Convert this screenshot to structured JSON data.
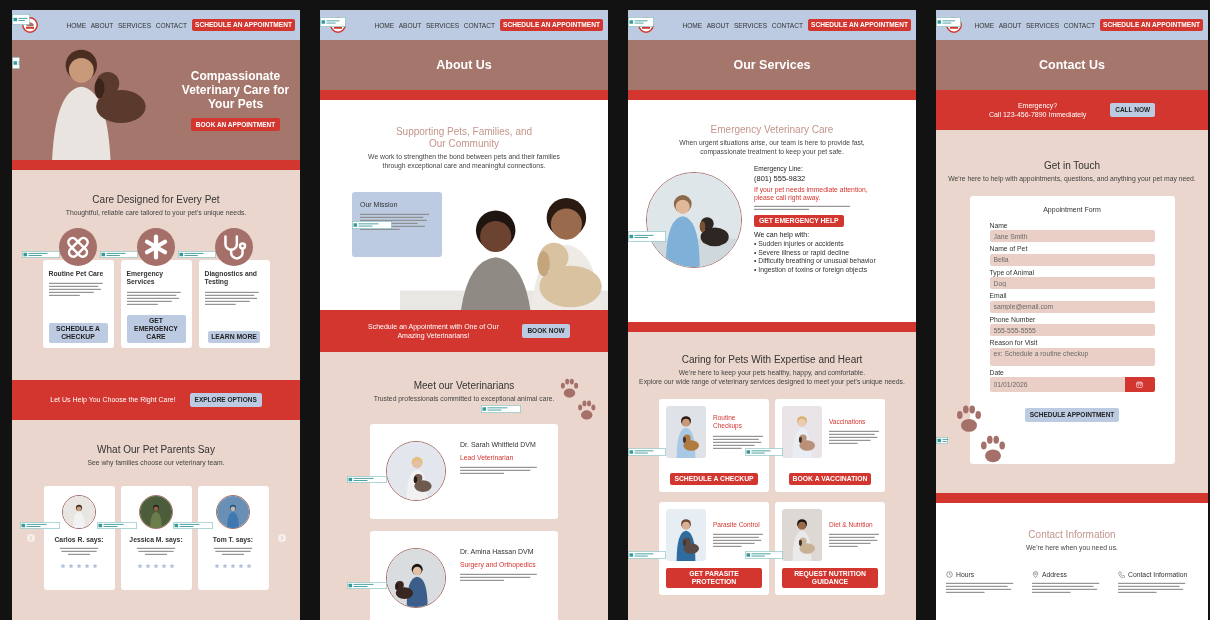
{
  "pages": [
    {
      "nav": {
        "links": [
          "HOME",
          "ABOUT",
          "SERVICES",
          "CONTACT"
        ],
        "button": "SCHEDULE AN APPOINTMENT"
      },
      "sections": [
        {
          "kind": "hero",
          "title": "Compassionate Veterinary Care for Your Pets",
          "button": "BOOK AN APPOINTMENT"
        },
        {
          "kind": "band"
        },
        {
          "kind": "features",
          "title": "Care Designed for Every Pet",
          "subtitle": "Thoughtful, reliable care tailored to your pet's unique needs.",
          "cards": [
            {
              "title": "Routine Pet Care",
              "button": "SCHEDULE A CHECKUP"
            },
            {
              "title": "Emergency Services",
              "button": "GET EMERGENCY CARE"
            },
            {
              "title": "Diagnostics and Testing",
              "button": "LEARN MORE"
            }
          ]
        },
        {
          "kind": "cta",
          "text": "Let Us Help You Choose the Right Care!",
          "button": "EXPLORE OPTIONS"
        },
        {
          "kind": "testimonials",
          "title": "What Our Pet Parents Say",
          "subtitle": "See why families choose our veterinary team.",
          "items": [
            {
              "name": "Carlos R. says:",
              "stars": 5
            },
            {
              "name": "Jessica M. says:",
              "stars": 5
            },
            {
              "name": "Tom T. says:",
              "stars": 5
            }
          ]
        }
      ]
    },
    {
      "nav": {
        "links": [
          "HOME",
          "ABOUT",
          "SERVICES",
          "CONTACT"
        ],
        "button": "SCHEDULE AN APPOINTMENT"
      },
      "sections": [
        {
          "kind": "banner",
          "title": "About Us"
        },
        {
          "kind": "band"
        },
        {
          "kind": "intro",
          "title": "Supporting Pets, Families, and Our Community",
          "subtitle": "We work to strengthen the bond between pets and their families through exceptional care and meaningful connections.",
          "panel_title": "Our Mission"
        },
        {
          "kind": "cta",
          "text": "Schedule an Appointment with One of Our Amazing Veterinarians!",
          "button": "BOOK NOW"
        },
        {
          "kind": "team",
          "title": "Meet our Veterinarians",
          "subtitle": "Trusted professionals committed to exceptional animal care.",
          "members": [
            {
              "name": "Dr. Sarah Whitfield DVM",
              "role": "Lead Veterinarian"
            },
            {
              "name": "Dr. Amina Hassan DVM",
              "role": "Surgery and Orthopedics"
            }
          ]
        }
      ]
    },
    {
      "nav": {
        "links": [
          "HOME",
          "ABOUT",
          "SERVICES",
          "CONTACT"
        ],
        "button": "SCHEDULE AN APPOINTMENT"
      },
      "sections": [
        {
          "kind": "banner",
          "title": "Our Services"
        },
        {
          "kind": "band"
        },
        {
          "kind": "emergency",
          "title": "Emergency Veterinary Care",
          "subtitle": "When urgent situations arise, our team is here to provide fast, compassionate treatment to keep your pet safe.",
          "line_label": "Emergency Line:",
          "phone": "(801) 555-9832",
          "alert": "If your pet needs immediate attention, please call right away.",
          "button": "GET EMERGENCY HELP",
          "list_title": "We can help with:",
          "list": [
            "• Sudden injuries or accidents",
            "• Severe illness or rapid decline",
            "• Difficulty breathing or unusual behavior",
            "• Ingestion of toxins or foreign objects"
          ]
        },
        {
          "kind": "band"
        },
        {
          "kind": "services",
          "title": "Caring for Pets With Expertise and Heart",
          "subtitle_lines": [
            "We're here to keep your pets healthy, happy, and comfortable.",
            "Explore our wide range of veterinary services designed to meet your pet's unique needs."
          ],
          "cards": [
            {
              "title": "Routine Checkups",
              "button": "SCHEDULE A CHECKUP"
            },
            {
              "title": "Vaccinations",
              "button": "BOOK A VACCINATION"
            },
            {
              "title": "Parasite Control",
              "button": "GET PARASITE PROTECTION"
            },
            {
              "title": "Diet & Nutrition",
              "button": "REQUEST NUTRITION GUIDANCE"
            }
          ]
        }
      ]
    },
    {
      "nav": {
        "links": [
          "HOME",
          "ABOUT",
          "SERVICES",
          "CONTACT"
        ],
        "button": "SCHEDULE AN APPOINTMENT"
      },
      "sections": [
        {
          "kind": "banner",
          "title": "Contact Us"
        },
        {
          "kind": "alert_cta",
          "text_lines": [
            "Emergency?",
            "Call 123-456-7890 Immediately"
          ],
          "button": "CALL NOW"
        },
        {
          "kind": "form",
          "title": "Get in Touch",
          "subtitle": "We're here to help with appointments, questions, and anything your pet may need.",
          "form_title": "Appointment Form",
          "fields": [
            {
              "kind": "text",
              "label": "Name",
              "placeholder": "Jane Smith"
            },
            {
              "kind": "text",
              "label": "Name of Pet",
              "placeholder": "Bella"
            },
            {
              "kind": "text",
              "label": "Type of Animal",
              "placeholder": "Dog"
            },
            {
              "kind": "text",
              "label": "Email",
              "placeholder": "sample@email.com"
            },
            {
              "kind": "text",
              "label": "Phone Number",
              "placeholder": "555-555-5555"
            },
            {
              "kind": "textarea",
              "label": "Reason for Visit",
              "placeholder": "ex: Schedule a routine checkup"
            },
            {
              "kind": "date",
              "label": "Date",
              "placeholder": "01/01/2026"
            }
          ],
          "button": "SCHEDULE APPOINTMENT"
        },
        {
          "kind": "band"
        },
        {
          "kind": "info",
          "title": "Contact Information",
          "subtitle": "We're here when you need us.",
          "columns": [
            {
              "title": "Hours"
            },
            {
              "title": "Address"
            },
            {
              "title": "Contact Information"
            }
          ]
        }
      ]
    }
  ]
}
